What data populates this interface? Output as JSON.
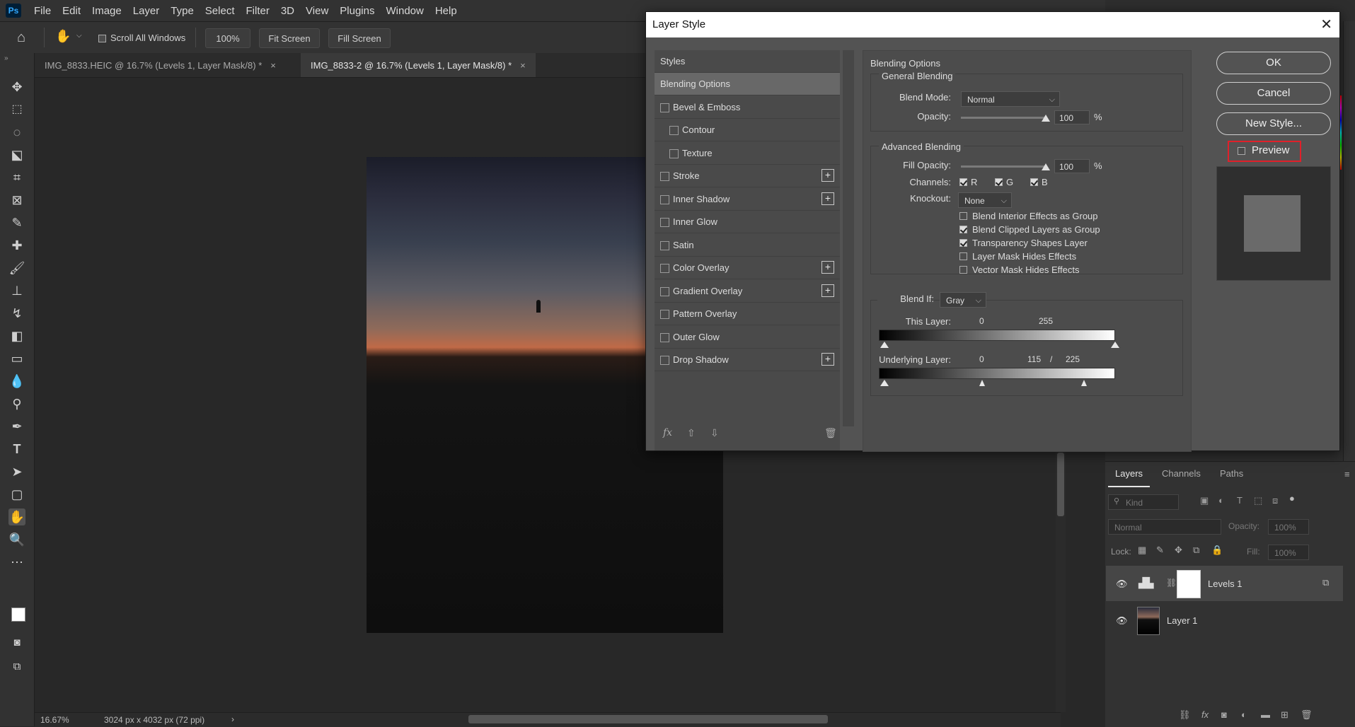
{
  "app": {
    "logo": "Ps",
    "menu": [
      "File",
      "Edit",
      "Image",
      "Layer",
      "Type",
      "Select",
      "Filter",
      "3D",
      "View",
      "Plugins",
      "Window",
      "Help"
    ]
  },
  "options_bar": {
    "scroll_all_windows": "Scroll All Windows",
    "zoom_pct": "100%",
    "fit_screen": "Fit Screen",
    "fill_screen": "Fill Screen"
  },
  "tabs": [
    {
      "label": "IMG_8833.HEIC @ 16.7% (Levels 1, Layer Mask/8) *",
      "close": "×"
    },
    {
      "label": "IMG_8833-2 @ 16.7% (Levels 1, Layer Mask/8) *",
      "close": "×"
    }
  ],
  "status": {
    "zoom": "16.67%",
    "doc_info": "3024 px x 4032 px (72 ppi)",
    "arrow": "›"
  },
  "dialog": {
    "title": "Layer Style",
    "close": "✕",
    "styles_header": "Styles",
    "styles": [
      {
        "label": "Blending Options",
        "checkbox": false,
        "plus": false,
        "indent": false,
        "selected": true
      },
      {
        "label": "Bevel & Emboss",
        "checkbox": true,
        "plus": false,
        "indent": false
      },
      {
        "label": "Contour",
        "checkbox": true,
        "plus": false,
        "indent": true
      },
      {
        "label": "Texture",
        "checkbox": true,
        "plus": false,
        "indent": true
      },
      {
        "label": "Stroke",
        "checkbox": true,
        "plus": true,
        "indent": false
      },
      {
        "label": "Inner Shadow",
        "checkbox": true,
        "plus": true,
        "indent": false
      },
      {
        "label": "Inner Glow",
        "checkbox": true,
        "plus": false,
        "indent": false
      },
      {
        "label": "Satin",
        "checkbox": true,
        "plus": false,
        "indent": false
      },
      {
        "label": "Color Overlay",
        "checkbox": true,
        "plus": true,
        "indent": false
      },
      {
        "label": "Gradient Overlay",
        "checkbox": true,
        "plus": true,
        "indent": false
      },
      {
        "label": "Pattern Overlay",
        "checkbox": true,
        "plus": false,
        "indent": false
      },
      {
        "label": "Outer Glow",
        "checkbox": true,
        "plus": false,
        "indent": false
      },
      {
        "label": "Drop Shadow",
        "checkbox": true,
        "plus": true,
        "indent": false
      }
    ],
    "footer_fx": "fx",
    "blending": {
      "title": "Blending Options",
      "general_title": "General Blending",
      "blend_mode_label": "Blend Mode:",
      "blend_mode": "Normal",
      "opacity_label": "Opacity:",
      "opacity": "100",
      "pct": "%",
      "advanced_title": "Advanced Blending",
      "fill_opacity_label": "Fill Opacity:",
      "fill_opacity": "100",
      "channels_label": "Channels:",
      "channels": [
        "R",
        "G",
        "B"
      ],
      "knockout_label": "Knockout:",
      "knockout": "None",
      "options": [
        {
          "label": "Blend Interior Effects as Group",
          "checked": false
        },
        {
          "label": "Blend Clipped Layers as Group",
          "checked": true
        },
        {
          "label": "Transparency Shapes Layer",
          "checked": true
        },
        {
          "label": "Layer Mask Hides Effects",
          "checked": false
        },
        {
          "label": "Vector Mask Hides Effects",
          "checked": false
        }
      ],
      "blend_if_label": "Blend If:",
      "blend_if": "Gray",
      "this_layer_label": "This Layer:",
      "this_layer_min": "0",
      "this_layer_max": "255",
      "underlying_label": "Underlying Layer:",
      "underlying_min": "0",
      "underlying_mid1": "115",
      "underlying_slash": "/",
      "underlying_mid2": "225"
    },
    "buttons": {
      "ok": "OK",
      "cancel": "Cancel",
      "new_style": "New Style...",
      "preview": "Preview"
    }
  },
  "layers_panel": {
    "tabs": [
      "Layers",
      "Channels",
      "Paths"
    ],
    "kind": "Kind",
    "blend": "Normal",
    "opacity_label": "Opacity:",
    "opacity": "100%",
    "lock_label": "Lock:",
    "fill_label": "Fill:",
    "fill": "100%",
    "layers": [
      {
        "name": "Levels 1",
        "selected": true
      },
      {
        "name": "Layer 1",
        "selected": false
      }
    ]
  }
}
